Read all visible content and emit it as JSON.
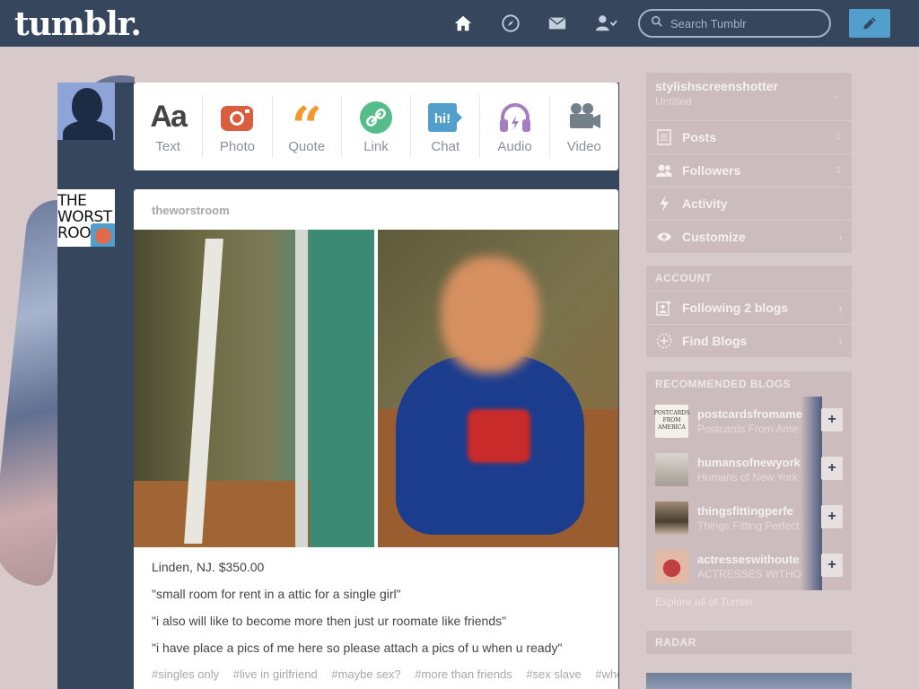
{
  "header": {
    "logo": "tumblr.",
    "search_placeholder": "Search Tumblr"
  },
  "post_types": [
    {
      "label": "Text",
      "icon": "text-icon",
      "color": "#444444"
    },
    {
      "label": "Photo",
      "icon": "camera-icon",
      "color": "#d95e40"
    },
    {
      "label": "Quote",
      "icon": "quote-icon",
      "color": "#f2992e"
    },
    {
      "label": "Link",
      "icon": "link-icon",
      "color": "#56bc8a"
    },
    {
      "label": "Chat",
      "icon": "chat-icon",
      "color": "#529ecc"
    },
    {
      "label": "Audio",
      "icon": "headphones-icon",
      "color": "#a77dc2"
    },
    {
      "label": "Video",
      "icon": "video-camera-icon",
      "color": "#748089"
    }
  ],
  "avatar_post_text": "THE WORST ROO",
  "post": {
    "author": "theworstroom",
    "caption": [
      "Linden, NJ. $350.00",
      "\"small room for rent in a attic for a single girl\"",
      "\"i also will like to become more then just ur roomate like friends\"",
      "\"i have place a pics of me here so please attach a pics of u when u ready\""
    ],
    "tags": [
      "#singles only",
      "#live in girlfriend",
      "#maybe sex?",
      "#more than friends",
      "#sex slave",
      "#whe"
    ]
  },
  "sidebar": {
    "blog_name": "stylishscreenshotter",
    "blog_subtitle": "Untitled",
    "menu": [
      {
        "label": "Posts",
        "count": "0"
      },
      {
        "label": "Followers",
        "count": "3"
      },
      {
        "label": "Activity",
        "count": ""
      },
      {
        "label": "Customize",
        "count": ""
      }
    ],
    "account_title": "ACCOUNT",
    "account": [
      {
        "label": "Following 2 blogs"
      },
      {
        "label": "Find Blogs"
      }
    ],
    "recommended_title": "RECOMMENDED BLOGS",
    "recommended": [
      {
        "name": "postcardsfromame",
        "sub": "Postcards From Ame",
        "thumb_text": "POSTCARDS FROM AMERICA",
        "thumb_color": "#f4f1ea"
      },
      {
        "name": "humansofnewyork",
        "sub": "Humans of New York",
        "thumb_color": "#c6c0b8"
      },
      {
        "name": "thingsfittingperfe",
        "sub": "Things Fitting Perfect",
        "thumb_color": "#8a7a66"
      },
      {
        "name": "actresseswithoute",
        "sub": "ACTRESSES WITHO",
        "thumb_color": "#b34c4c"
      }
    ],
    "explore": "Explore all of Tumblr",
    "radar_title": "RADAR"
  },
  "colors": {
    "header": "#36465d",
    "background": "#d8c9cb",
    "compose": "#529ecc"
  }
}
